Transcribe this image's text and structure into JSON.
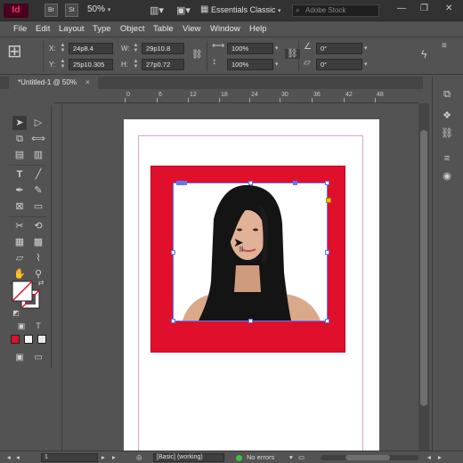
{
  "appbar": {
    "logo": "Id",
    "bridge_button": "Br",
    "stock_button": "St",
    "zoom": "50%",
    "workspace": "Essentials Classic",
    "search_placeholder": "Adobe Stock",
    "minimize": "—",
    "restore": "❐",
    "close": "✕"
  },
  "menu": [
    "File",
    "Edit",
    "Layout",
    "Type",
    "Object",
    "Table",
    "View",
    "Window",
    "Help"
  ],
  "control": {
    "x_label": "X:",
    "x_value": "24p8.4",
    "y_label": "Y:",
    "y_value": "25p10.305",
    "w_label": "W:",
    "w_value": "29p10.8",
    "h_label": "H:",
    "h_value": "27p0.72",
    "scale_x": "100%",
    "scale_y": "100%",
    "rotate": "0°",
    "shear": "0°"
  },
  "tab": {
    "title": "*Untitled-1 @ 50%",
    "close": "×"
  },
  "ruler_ticks": [
    "0",
    "6",
    "12",
    "18",
    "24",
    "30",
    "36",
    "42",
    "48"
  ],
  "status": {
    "page": "1",
    "preflight_profile": "[Basic] (working)",
    "errors": "No errors"
  },
  "colors": {
    "accent_frame": "#e0102c",
    "selection": "#5b79ff",
    "ui_bg": "#535353",
    "status_ok": "#3fbf3f"
  },
  "icons": [
    "selection-icon",
    "direct-selection-icon",
    "page-icon",
    "gap-icon",
    "content-collector-icon",
    "type-icon",
    "line-icon",
    "pen-icon",
    "pencil-icon",
    "rectangle-frame-icon",
    "rectangle-icon",
    "scissors-icon",
    "free-transform-icon",
    "gradient-swatch-icon",
    "gradient-feather-icon",
    "note-icon",
    "eyedropper-icon",
    "hand-icon",
    "zoom-icon",
    "fill-stroke-icon",
    "pages-panel-icon",
    "layers-panel-icon",
    "links-panel-icon",
    "stroke-panel-icon",
    "swatches-panel-icon"
  ]
}
